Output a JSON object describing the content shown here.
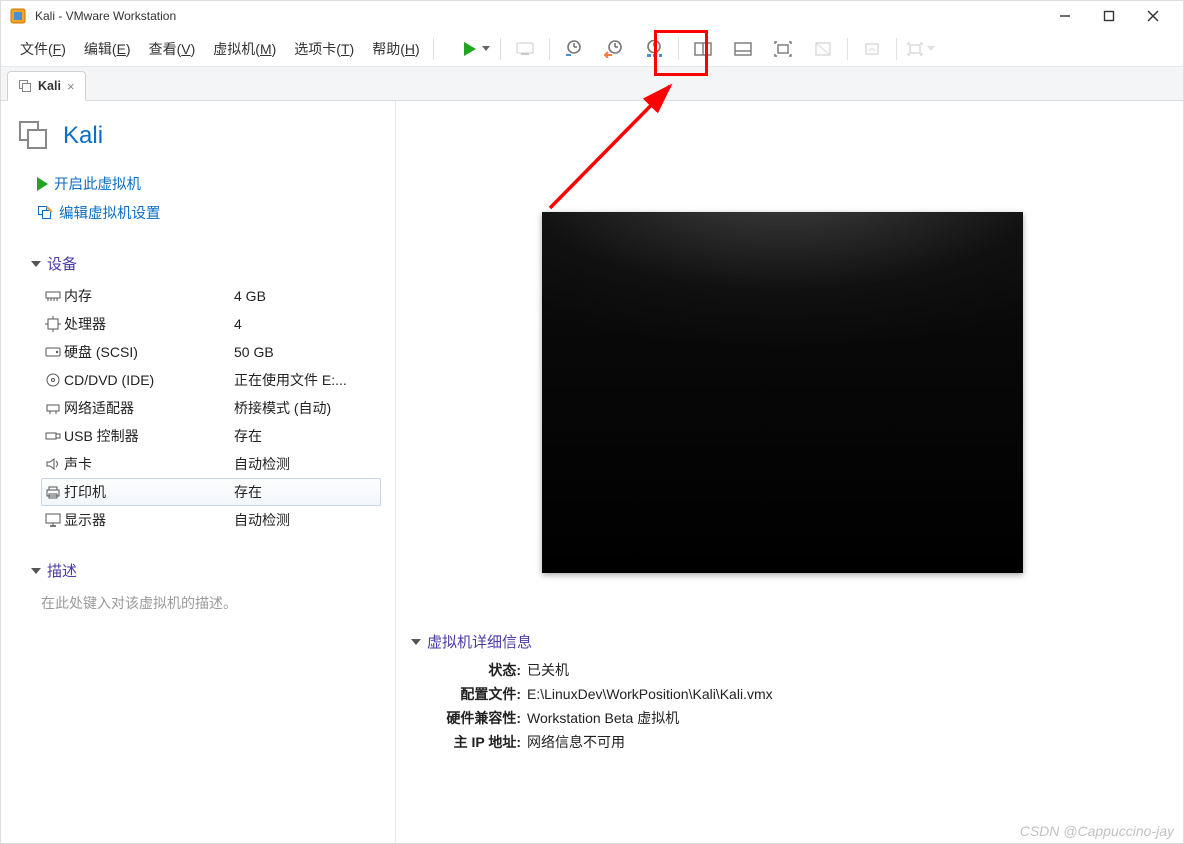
{
  "title": "Kali - VMware Workstation",
  "menus": {
    "file": {
      "pre": "文件(",
      "key": "F",
      "post": ")"
    },
    "edit": {
      "pre": "编辑(",
      "key": "E",
      "post": ")"
    },
    "view": {
      "pre": "查看(",
      "key": "V",
      "post": ")"
    },
    "vm": {
      "pre": "虚拟机(",
      "key": "M",
      "post": ")"
    },
    "tabs": {
      "pre": "选项卡(",
      "key": "T",
      "post": ")"
    },
    "help": {
      "pre": "帮助(",
      "key": "H",
      "post": ")"
    }
  },
  "tab": {
    "label": "Kali"
  },
  "vm": {
    "name": "Kali",
    "actions": {
      "power_on": "开启此虚拟机",
      "edit_settings": "编辑虚拟机设置"
    },
    "section_devices": "设备",
    "devices": [
      {
        "icon": "memory",
        "name": "内存",
        "value": "4 GB"
      },
      {
        "icon": "cpu",
        "name": "处理器",
        "value": "4"
      },
      {
        "icon": "disk",
        "name": "硬盘 (SCSI)",
        "value": "50 GB"
      },
      {
        "icon": "cd",
        "name": "CD/DVD (IDE)",
        "value": "正在使用文件 E:..."
      },
      {
        "icon": "net",
        "name": "网络适配器",
        "value": "桥接模式 (自动)"
      },
      {
        "icon": "usb",
        "name": "USB 控制器",
        "value": "存在"
      },
      {
        "icon": "sound",
        "name": "声卡",
        "value": "自动检测"
      },
      {
        "icon": "printer",
        "name": "打印机",
        "value": "存在",
        "selected": true
      },
      {
        "icon": "display",
        "name": "显示器",
        "value": "自动检测"
      }
    ],
    "section_desc": "描述",
    "desc_placeholder": "在此处键入对该虚拟机的描述。",
    "section_details": "虚拟机详细信息",
    "details": {
      "state_label": "状态:",
      "state": "已关机",
      "config_label": "配置文件:",
      "config": "E:\\LinuxDev\\WorkPosition\\Kali\\Kali.vmx",
      "compat_label": "硬件兼容性:",
      "compat": "Workstation Beta 虚拟机",
      "ip_label": "主 IP 地址:",
      "ip": "网络信息不可用"
    }
  },
  "watermark": "CSDN @Cappuccino-jay"
}
